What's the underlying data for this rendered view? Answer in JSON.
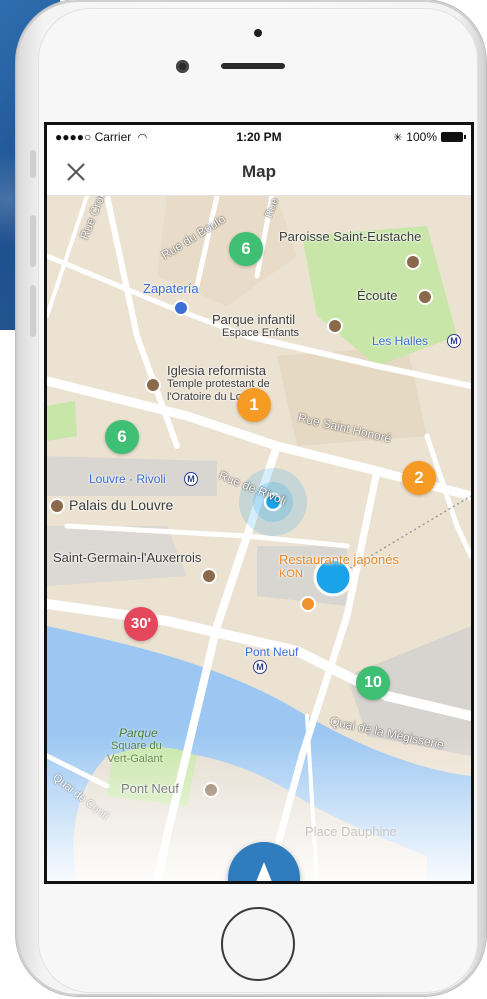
{
  "status_bar": {
    "carrier": "●●●●○ Carrier",
    "time": "1:20 PM",
    "battery": "100%"
  },
  "nav": {
    "title": "Map",
    "close_icon": "close-icon"
  },
  "map": {
    "streets": [
      "Rue du Boulo",
      "Rue Croix des Petits C",
      "Rue Saint Honoré",
      "Rue de Rivoli",
      "Quai de la Mégisserie",
      "Quai de Conti",
      "Rue"
    ],
    "places": {
      "paroisse": "Paroisse Saint-Eustache",
      "zapateria": "Zapatería",
      "ecoute": "Écoute",
      "parque_infantil": "Parque infantil",
      "espace_enfants": "Espace Enfants",
      "les_halles": "Les Halles",
      "iglesia": "Iglesia reformista",
      "temple": "Temple protestant de",
      "oratoire": "l'Oratoire du Louvre",
      "louvre_rivoli": "Louvre · Rivoli",
      "palais": "Palais du Louvre",
      "saint_germain": "Saint-Germain-l'Auxerrois",
      "restaurante": "Restaurante japonés",
      "kon": "KON",
      "pont_neuf_metro": "Pont Neuf",
      "parque": "Parque",
      "square": "Square du",
      "vert_galant": "Vert-Galant",
      "pont_neuf": "Pont Neuf",
      "place_dauphine": "Place Dauphine"
    },
    "badges": [
      {
        "name": "badge-green-6-top",
        "value": "6",
        "color": "#3fbf73"
      },
      {
        "name": "badge-orange-1",
        "value": "1",
        "color": "#f59a23"
      },
      {
        "name": "badge-green-6-left",
        "value": "6",
        "color": "#3fbf73"
      },
      {
        "name": "badge-orange-2",
        "value": "2",
        "color": "#f59a23"
      },
      {
        "name": "badge-red-30",
        "value": "30'",
        "color": "#e4475b"
      },
      {
        "name": "badge-green-10",
        "value": "10",
        "color": "#3fbf73"
      }
    ]
  },
  "colors": {
    "accent_blue": "#2f7cbe",
    "user_dot": "#1aa3e8",
    "water": "#9cc7f2",
    "park": "#c8e6a8"
  },
  "icons": {
    "navigate": "navigate-arrow-icon",
    "wifi": "wifi-icon",
    "bluetooth": "bluetooth-icon"
  }
}
